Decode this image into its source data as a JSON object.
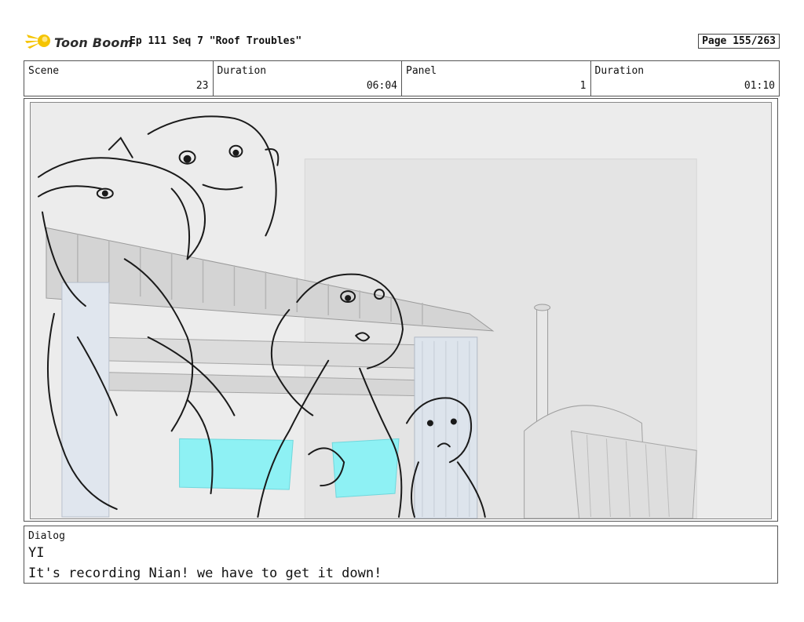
{
  "header": {
    "logo_text": "Toon Boom",
    "title": "Ep 111 Seq 7 \"Roof Troubles\"",
    "page": "Page 155/263"
  },
  "info": [
    {
      "label": "Scene",
      "value": "23"
    },
    {
      "label": "Duration",
      "value": "06:04"
    },
    {
      "label": "Panel",
      "value": "1"
    },
    {
      "label": "Duration",
      "value": "01:10"
    }
  ],
  "dialog": {
    "label": "Dialog",
    "speaker": "YI",
    "line": "It's recording Nian! we have to get it down!"
  },
  "colors": {
    "logo_yellow": "#f5c400",
    "panel_background": "#ececec",
    "screen_cyan": "#8ef1f4",
    "sketch_line": "#1a1a1a"
  },
  "icons": {
    "logo": "comet-logo-icon"
  }
}
